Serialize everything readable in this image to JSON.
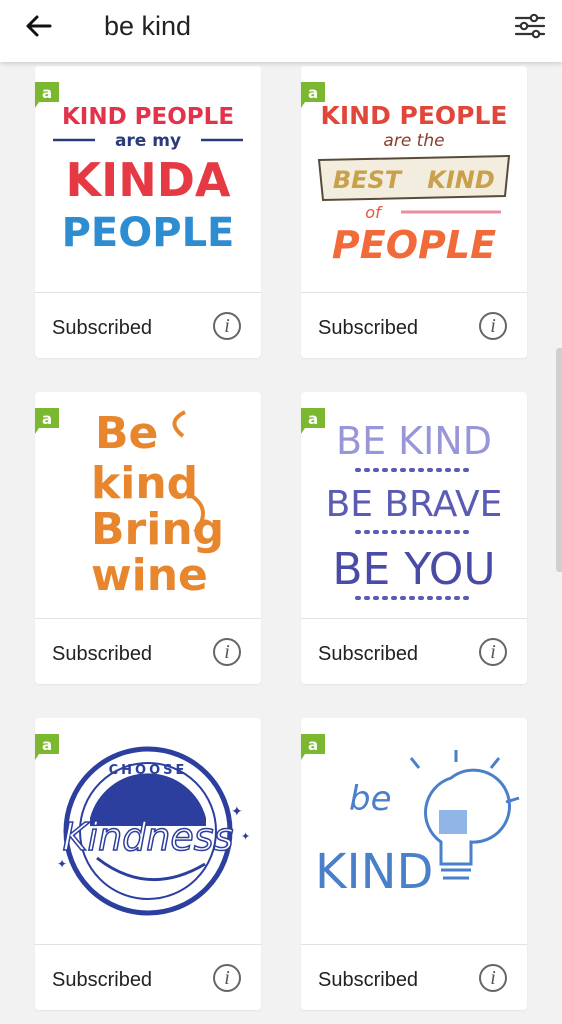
{
  "search": {
    "query": "be kind"
  },
  "icons": {
    "back": "arrow-left-icon",
    "filter": "sliders-icon",
    "info": "info-icon",
    "badge": "access-badge-icon"
  },
  "colors": {
    "badge_green": "#7cb82f",
    "info_gray": "#666666"
  },
  "badge_letter": "a",
  "cards": [
    {
      "status": "Subscribed",
      "info": "i",
      "art": {
        "lines": [
          "KIND PEOPLE",
          "are my",
          "KINDA",
          "PEOPLE"
        ]
      }
    },
    {
      "status": "Subscribed",
      "info": "i",
      "art": {
        "lines": [
          "KIND PEOPLE",
          "are the",
          "BEST",
          "KIND",
          "of",
          "PEOPLE"
        ]
      }
    },
    {
      "status": "Subscribed",
      "info": "i",
      "art": {
        "lines": [
          "Be",
          "kind",
          "Bring",
          "wine"
        ]
      }
    },
    {
      "status": "Subscribed",
      "info": "i",
      "art": {
        "lines": [
          "BE KIND",
          "BE BRAVE",
          "BE YOU"
        ]
      }
    },
    {
      "status": "Subscribed",
      "info": "i",
      "art": {
        "lines": [
          "CHOOSE",
          "Kindness"
        ]
      }
    },
    {
      "status": "Subscribed",
      "info": "i",
      "art": {
        "lines": [
          "be",
          "KIND"
        ]
      }
    }
  ]
}
